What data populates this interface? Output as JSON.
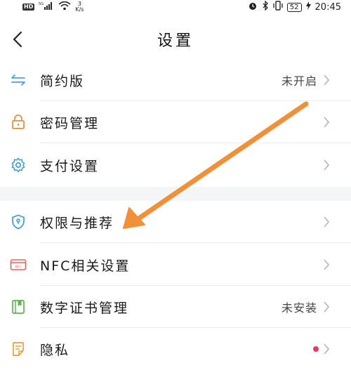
{
  "status_bar": {
    "network_badge": "HD",
    "signal_label": "5G",
    "speed_value": "3",
    "speed_unit": "K/s",
    "battery": "52",
    "time": "20:45"
  },
  "header": {
    "title": "设置"
  },
  "settings": [
    {
      "key": "simple_mode",
      "label": "简约版",
      "value": "未开启",
      "icon": "swap-arrows-icon",
      "color": "#4a9ee8"
    },
    {
      "key": "password",
      "label": "密码管理",
      "value": "",
      "icon": "lock-icon",
      "color": "#e8913b"
    },
    {
      "key": "payment",
      "label": "支付设置",
      "value": "",
      "icon": "gear-icon",
      "color": "#3a9bd8"
    },
    {
      "key": "permissions",
      "label": "权限与推荐",
      "value": "",
      "icon": "shield-icon",
      "color": "#3a9bd8"
    },
    {
      "key": "nfc",
      "label": "NFC相关设置",
      "value": "",
      "icon": "nfc-card-icon",
      "color": "#e8645a"
    },
    {
      "key": "certificate",
      "label": "数字证书管理",
      "value": "未安装",
      "icon": "certificate-icon",
      "color": "#58b84b"
    },
    {
      "key": "privacy",
      "label": "隐私",
      "value": "",
      "icon": "privacy-doc-icon",
      "color": "#e8a13b"
    }
  ],
  "annotation": {
    "arrow_color": "#f0913a"
  }
}
